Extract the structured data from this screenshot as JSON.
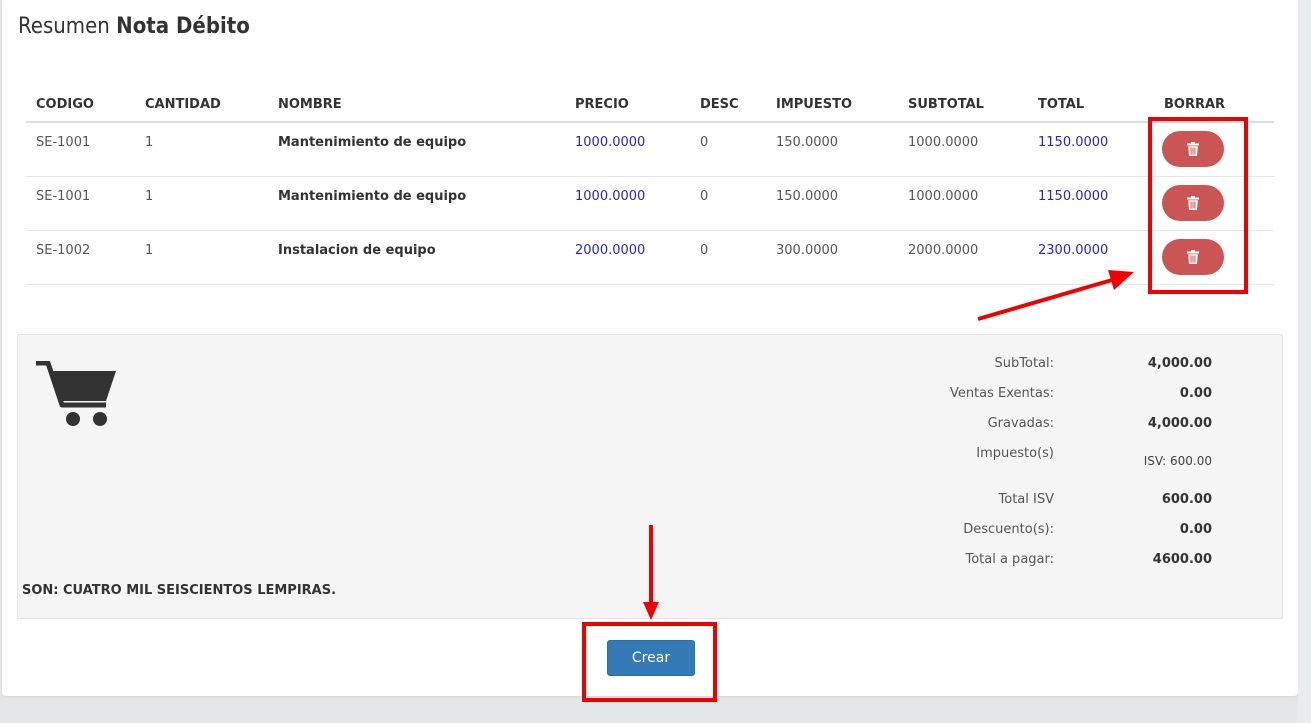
{
  "title": {
    "prefix": "Resumen",
    "bold": "Nota Débito"
  },
  "table": {
    "headers": [
      "CODIGO",
      "CANTIDAD",
      "NOMBRE",
      "PRECIO",
      "DESC",
      "IMPUESTO",
      "SUBTOTAL",
      "TOTAL",
      "BORRAR"
    ],
    "rows": [
      {
        "codigo": "SE-1001",
        "cantidad": "1",
        "nombre": "Mantenimiento de equipo",
        "precio": "1000.0000",
        "desc": "0",
        "impuesto": "150.0000",
        "subtotal": "1000.0000",
        "total": "1150.0000"
      },
      {
        "codigo": "SE-1001",
        "cantidad": "1",
        "nombre": "Mantenimiento de equipo",
        "precio": "1000.0000",
        "desc": "0",
        "impuesto": "150.0000",
        "subtotal": "1000.0000",
        "total": "1150.0000"
      },
      {
        "codigo": "SE-1002",
        "cantidad": "1",
        "nombre": "Instalacion de equipo",
        "precio": "2000.0000",
        "desc": "0",
        "impuesto": "300.0000",
        "subtotal": "2000.0000",
        "total": "2300.0000"
      }
    ]
  },
  "summary": {
    "subtotal_label": "SubTotal:",
    "subtotal": "4,000.00",
    "exentas_label": "Ventas Exentas:",
    "exentas": "0.00",
    "gravadas_label": "Gravadas:",
    "gravadas": "4,000.00",
    "impuestos_label": "Impuesto(s)",
    "impuestos": "ISV: 600.00",
    "total_isv_label": "Total ISV",
    "total_isv": "600.00",
    "descuentos_label": "Descuento(s):",
    "descuentos": "0.00",
    "total_pagar_label": "Total a pagar:",
    "total_pagar": "4600.00",
    "son": "SON: CUATRO MIL SEISCIENTOS LEMPIRAS."
  },
  "actions": {
    "crear_label": "Crear"
  },
  "colors": {
    "delete_button": "#cb5454",
    "primary_button": "#337ab7",
    "annotation": "#f20000",
    "link_values": "#2626c9"
  },
  "icons": {
    "delete": "trash-icon",
    "cart": "shopping-cart-icon"
  }
}
